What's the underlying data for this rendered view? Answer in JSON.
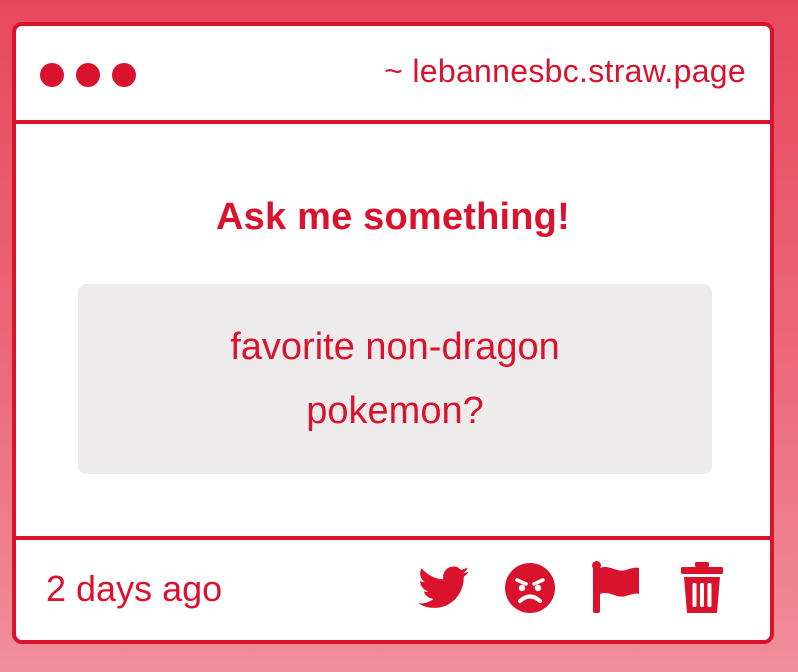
{
  "window": {
    "domain": "~ lebannesbc.straw.page"
  },
  "main": {
    "heading": "Ask me something!",
    "question": "favorite non-dragon pokemon?"
  },
  "footer": {
    "timestamp": "2 days ago",
    "actions": [
      {
        "icon": "twitter-icon"
      },
      {
        "icon": "angry-face-icon"
      },
      {
        "icon": "flag-icon"
      },
      {
        "icon": "trash-icon"
      }
    ]
  },
  "colors": {
    "accent": "#d9132e",
    "question_background": "#edebec",
    "card_background": "#ffffff"
  }
}
